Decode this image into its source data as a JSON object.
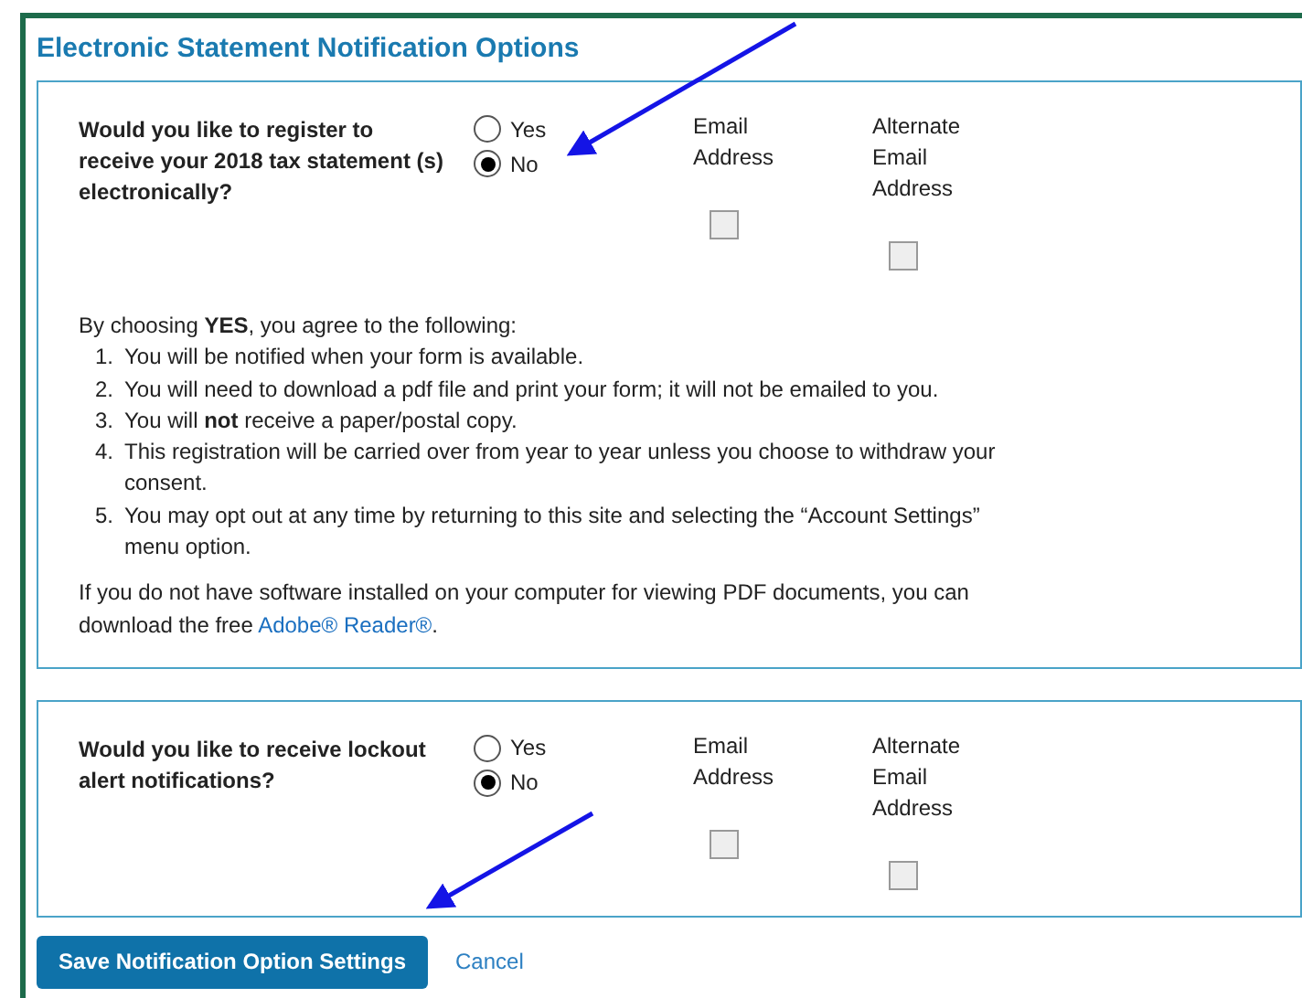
{
  "title": "Electronic Statement Notification Options",
  "sections": [
    {
      "question": "Would you like to register to receive your 2018 tax statement (s) electronically?",
      "options": [
        {
          "label": "Yes",
          "selected": false
        },
        {
          "label": "No",
          "selected": true
        }
      ],
      "columns": [
        {
          "label": "Email Address",
          "checked": false
        },
        {
          "label": "Alternate Email Address",
          "checked": false
        }
      ],
      "intro": "By choosing **YES**, you agree to the following:",
      "items": [
        {
          "num": "1.",
          "text": "You will be notified when your form is available."
        },
        {
          "num": "2.",
          "text": "You will need to download a pdf file and print your form; it will not be emailed to you."
        },
        {
          "num": "3.",
          "text": "You will **not** receive a paper/postal copy."
        },
        {
          "num": "4.",
          "text": "This registration will be carried over from year to year unless you choose to withdraw your consent."
        },
        {
          "num": "5.",
          "text": "You may opt out at any time by returning to this site and selecting the “Account Settings” menu option."
        }
      ],
      "note": "If you do not have software installed on your computer for viewing PDF documents, you can download the free",
      "link": "Adobe® Reader®",
      "note_end": "."
    },
    {
      "question": "Would you like to receive lockout alert notifications?",
      "options": [
        {
          "label": "Yes",
          "selected": false
        },
        {
          "label": "No",
          "selected": true
        }
      ],
      "columns": [
        {
          "label": "Email Address",
          "checked": false
        },
        {
          "label": "Alternate Email Address",
          "checked": false
        }
      ]
    }
  ],
  "buttons": {
    "save": "Save Notification Option Settings",
    "cancel": "Cancel"
  }
}
